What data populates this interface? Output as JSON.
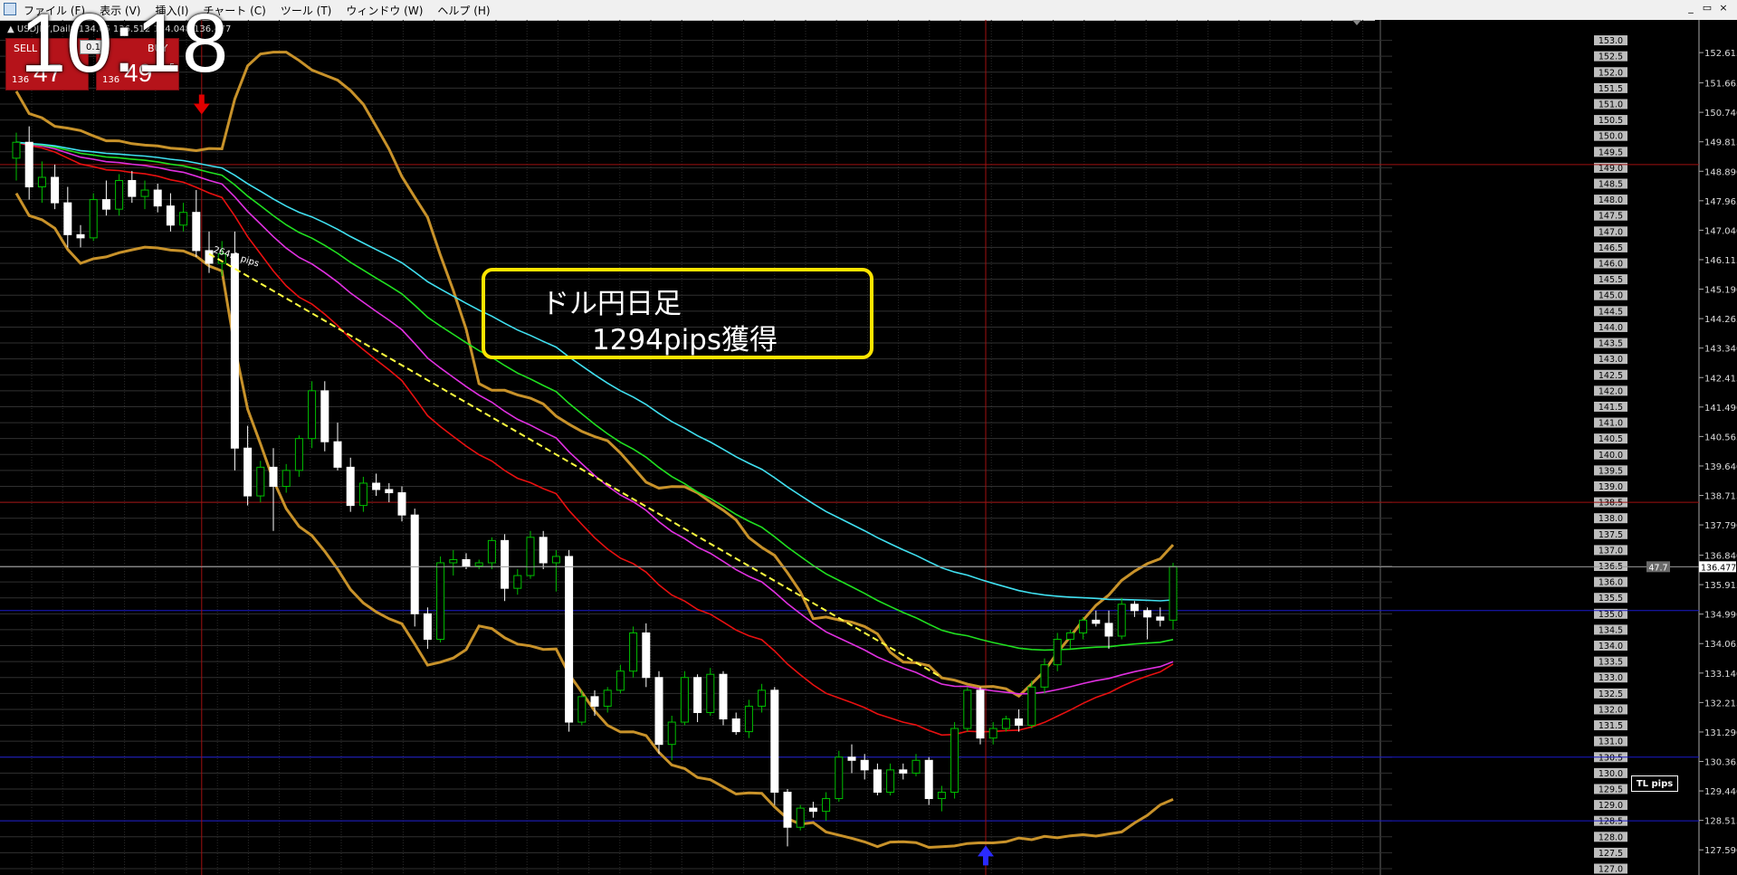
{
  "menubar": {
    "items": [
      "ファイル (F)",
      "表示 (V)",
      "挿入(I)",
      "チャート (C)",
      "ツール (T)",
      "ウィンドウ (W)",
      "ヘルプ (H)"
    ],
    "window_buttons": [
      "_",
      "▭",
      "×"
    ]
  },
  "clock": "10:18",
  "symbol_info": "▲ USDJPY,Daily 134.65 136.512 134.048 136.477",
  "trade_panel": {
    "sell": {
      "label": "SELL",
      "small": "136",
      "big": "47"
    },
    "buy": {
      "label": "BUY",
      "small": "136",
      "big": "49",
      "sup": "5"
    },
    "lot": "0.1"
  },
  "annotation": {
    "line1": "ドル円日足",
    "line2": "1294pips獲得"
  },
  "trendline_label": "264.0 pips",
  "tl_pips_button": "TL pips",
  "spread_label": "47.7",
  "current_price": "136.477",
  "round_levels": [
    "153.0",
    "152.5",
    "152.0",
    "151.5",
    "151.0",
    "150.5",
    "150.0",
    "149.5",
    "149.0",
    "148.5",
    "148.0",
    "147.5",
    "147.0",
    "146.5",
    "146.0",
    "145.5",
    "145.0",
    "144.5",
    "144.0",
    "143.5",
    "143.0",
    "142.5",
    "142.0",
    "141.5",
    "141.0",
    "140.5",
    "140.0",
    "139.5",
    "139.0",
    "138.5",
    "138.0",
    "137.5",
    "137.0",
    "136.5",
    "136.0",
    "135.5",
    "135.0",
    "134.5",
    "134.0",
    "133.5",
    "133.0",
    "132.5",
    "132.0",
    "131.5",
    "131.0",
    "130.5",
    "130.0",
    "129.5",
    "129.0",
    "128.5",
    "128.0",
    "127.5",
    "127.0"
  ],
  "price_axis": [
    "152.615",
    "151.665",
    "150.740",
    "149.815",
    "148.890",
    "147.965",
    "147.040",
    "146.115",
    "145.190",
    "144.265",
    "143.340",
    "142.415",
    "141.490",
    "140.565",
    "139.640",
    "138.715",
    "137.790",
    "136.840",
    "135.915",
    "134.990",
    "134.065",
    "133.140",
    "132.215",
    "131.290",
    "130.365",
    "129.440",
    "128.515",
    "127.590"
  ],
  "chart_data": {
    "type": "candlestick",
    "symbol": "USDJPY",
    "timeframe": "Daily",
    "ylim": [
      127.0,
      153.3
    ],
    "candles": [
      [
        149.3,
        150.1,
        148.6,
        149.8
      ],
      [
        149.8,
        150.3,
        148.0,
        148.4
      ],
      [
        148.4,
        149.2,
        147.9,
        148.7
      ],
      [
        148.7,
        149.1,
        147.7,
        147.9
      ],
      [
        147.9,
        148.4,
        146.5,
        146.9
      ],
      [
        146.9,
        147.2,
        146.5,
        146.8
      ],
      [
        146.8,
        148.2,
        146.7,
        148.0
      ],
      [
        148.0,
        148.6,
        147.5,
        147.7
      ],
      [
        147.7,
        148.8,
        147.5,
        148.6
      ],
      [
        148.6,
        148.9,
        147.9,
        148.1
      ],
      [
        148.1,
        148.6,
        147.7,
        148.3
      ],
      [
        148.3,
        148.5,
        147.6,
        147.8
      ],
      [
        147.8,
        148.2,
        147.0,
        147.2
      ],
      [
        147.2,
        147.9,
        147.0,
        147.6
      ],
      [
        147.6,
        148.3,
        146.2,
        146.4
      ],
      [
        146.4,
        147.0,
        145.7,
        146.0
      ],
      [
        146.0,
        146.7,
        145.6,
        146.3
      ],
      [
        146.3,
        147.0,
        139.5,
        140.2
      ],
      [
        140.2,
        140.9,
        138.4,
        138.7
      ],
      [
        138.7,
        139.8,
        138.5,
        139.6
      ],
      [
        139.6,
        140.2,
        137.6,
        139.0
      ],
      [
        139.0,
        139.7,
        138.8,
        139.5
      ],
      [
        139.5,
        140.6,
        139.3,
        140.5
      ],
      [
        140.5,
        142.3,
        140.2,
        142.0
      ],
      [
        142.0,
        142.3,
        140.1,
        140.4
      ],
      [
        140.4,
        141.0,
        139.5,
        139.6
      ],
      [
        139.6,
        139.9,
        138.2,
        138.4
      ],
      [
        138.4,
        139.3,
        138.2,
        139.1
      ],
      [
        139.1,
        139.4,
        138.7,
        138.9
      ],
      [
        138.9,
        139.1,
        138.5,
        138.8
      ],
      [
        138.8,
        139.0,
        137.9,
        138.1
      ],
      [
        138.1,
        138.3,
        134.6,
        135.0
      ],
      [
        135.0,
        135.2,
        133.9,
        134.2
      ],
      [
        134.2,
        136.8,
        134.1,
        136.6
      ],
      [
        136.6,
        137.0,
        136.2,
        136.7
      ],
      [
        136.7,
        136.9,
        136.4,
        136.5
      ],
      [
        136.5,
        136.7,
        136.4,
        136.6
      ],
      [
        136.6,
        137.4,
        136.4,
        137.3
      ],
      [
        137.3,
        137.5,
        135.4,
        135.8
      ],
      [
        135.8,
        136.4,
        135.6,
        136.2
      ],
      [
        136.2,
        137.6,
        136.1,
        137.4
      ],
      [
        137.4,
        137.6,
        136.4,
        136.6
      ],
      [
        136.6,
        137.0,
        135.7,
        136.8
      ],
      [
        136.8,
        137.0,
        131.3,
        131.6
      ],
      [
        131.6,
        132.6,
        131.5,
        132.4
      ],
      [
        132.4,
        132.6,
        131.8,
        132.1
      ],
      [
        132.1,
        132.7,
        131.9,
        132.6
      ],
      [
        132.6,
        133.4,
        132.5,
        133.2
      ],
      [
        133.2,
        134.6,
        133.0,
        134.4
      ],
      [
        134.4,
        134.7,
        132.7,
        133.0
      ],
      [
        133.0,
        133.2,
        130.6,
        130.9
      ],
      [
        130.9,
        131.8,
        130.4,
        131.6
      ],
      [
        131.6,
        133.2,
        131.5,
        133.0
      ],
      [
        133.0,
        133.1,
        131.6,
        131.9
      ],
      [
        131.9,
        133.3,
        131.8,
        133.1
      ],
      [
        133.1,
        133.2,
        131.5,
        131.7
      ],
      [
        131.7,
        131.9,
        131.2,
        131.3
      ],
      [
        131.3,
        132.3,
        131.1,
        132.1
      ],
      [
        132.1,
        132.8,
        131.9,
        132.6
      ],
      [
        132.6,
        132.7,
        129.0,
        129.4
      ],
      [
        129.4,
        129.5,
        127.7,
        128.3
      ],
      [
        128.3,
        129.0,
        128.2,
        128.9
      ],
      [
        128.9,
        129.1,
        128.6,
        128.8
      ],
      [
        128.8,
        129.4,
        128.5,
        129.2
      ],
      [
        129.2,
        130.7,
        129.1,
        130.5
      ],
      [
        130.5,
        130.9,
        130.0,
        130.4
      ],
      [
        130.4,
        130.6,
        129.8,
        130.1
      ],
      [
        130.1,
        130.3,
        129.3,
        129.4
      ],
      [
        129.4,
        130.3,
        129.3,
        130.1
      ],
      [
        130.1,
        130.3,
        129.8,
        130.0
      ],
      [
        130.0,
        130.6,
        129.9,
        130.4
      ],
      [
        130.4,
        130.5,
        129.0,
        129.2
      ],
      [
        129.2,
        129.6,
        128.8,
        129.4
      ],
      [
        129.4,
        131.6,
        129.2,
        131.4
      ],
      [
        131.4,
        132.7,
        131.3,
        132.6
      ],
      [
        132.6,
        132.7,
        130.9,
        131.1
      ],
      [
        131.1,
        131.6,
        130.9,
        131.4
      ],
      [
        131.4,
        131.8,
        131.3,
        131.7
      ],
      [
        131.7,
        132.0,
        131.3,
        131.5
      ],
      [
        131.5,
        132.9,
        131.4,
        132.7
      ],
      [
        132.7,
        133.6,
        132.5,
        133.4
      ],
      [
        133.4,
        134.4,
        133.2,
        134.2
      ],
      [
        134.2,
        134.5,
        133.9,
        134.4
      ],
      [
        134.4,
        134.9,
        134.2,
        134.8
      ],
      [
        134.8,
        135.1,
        134.6,
        134.7
      ],
      [
        134.7,
        135.1,
        133.9,
        134.3
      ],
      [
        134.3,
        135.5,
        134.2,
        135.3
      ],
      [
        135.3,
        135.4,
        134.9,
        135.1
      ],
      [
        135.1,
        135.2,
        134.2,
        134.9
      ],
      [
        134.9,
        135.2,
        134.6,
        134.8
      ],
      [
        134.8,
        136.6,
        134.5,
        136.48
      ]
    ],
    "indicators": [
      "Bollinger upper (gold)",
      "Bollinger lower (gold)",
      "Moving average (green)",
      "Moving average (cyan)",
      "Moving average (red)",
      "Moving average (magenta)"
    ],
    "horizontal_lines": [
      {
        "price": 149.1,
        "color": "#a01010"
      },
      {
        "price": 138.5,
        "color": "#a01010"
      },
      {
        "price": 135.1,
        "color": "#1a1acc"
      },
      {
        "price": 130.5,
        "color": "#1a1acc"
      },
      {
        "price": 128.5,
        "color": "#1a1acc"
      }
    ],
    "signals": [
      {
        "type": "sell-arrow",
        "candle": 14,
        "color": "#e00000"
      },
      {
        "type": "buy-arrow",
        "candle": 75,
        "color": "#2a2aff"
      }
    ]
  }
}
